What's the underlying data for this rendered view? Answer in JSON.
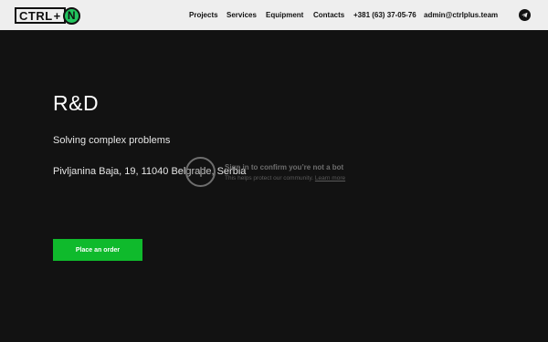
{
  "logo": {
    "text": "CTRL",
    "plus": "+",
    "badge": "N"
  },
  "nav": {
    "projects": "Projects",
    "services": "Services",
    "equipment": "Equipment",
    "contacts": "Contacts",
    "phone": "+381 (63) 37-05-76",
    "email": "admin@ctrlplus.team"
  },
  "icons": {
    "messenger": "telegram-icon",
    "overlay": "play-icon"
  },
  "hero": {
    "title": "R&D",
    "subtitle": "Solving complex problems",
    "address": "Pivljanina Baja, 19, 11040 Belgrade, Serbia",
    "order_button": "Place an order"
  },
  "bot_check": {
    "heading": "Sign in to confirm you’re not a bot",
    "sub": "This helps protect our community.",
    "learn_more": "Learn more"
  },
  "colors": {
    "header_bg": "#eeeeee",
    "page_bg": "#121212",
    "accent": "#0fba2c",
    "logo_green": "#22c45e"
  }
}
